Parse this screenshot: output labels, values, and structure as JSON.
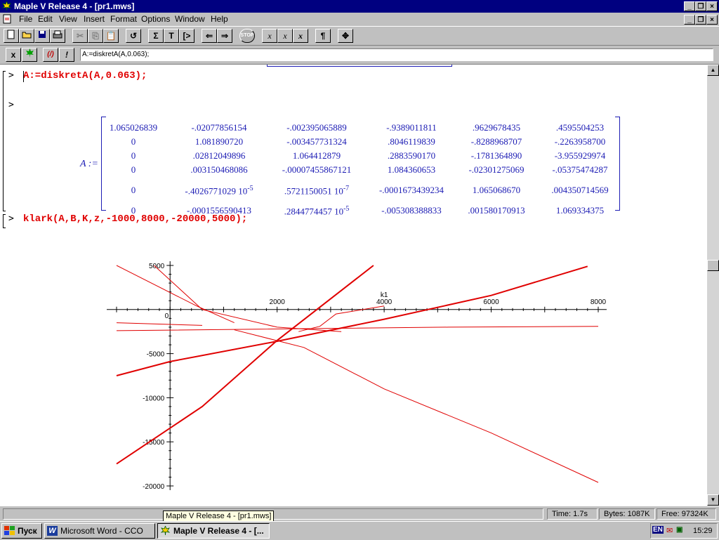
{
  "window": {
    "title": "Maple V Release 4 - [pr1.mws]"
  },
  "menu": [
    "File",
    "Edit",
    "View",
    "Insert",
    "Format",
    "Options",
    "Window",
    "Help"
  ],
  "toolbar": {
    "sigma": "Σ",
    "text": "T",
    "input": "[>",
    "para": "¶",
    "x1": "x",
    "x2": "x",
    "x3": "x"
  },
  "context": {
    "btn_x": "x",
    "btn_fn": "(/)",
    "btn_excl": "!",
    "command": "A:=diskretA(A,0.063);"
  },
  "worksheet": {
    "cmd1": "A:=diskretA(A,0.063);",
    "cmd2": "klark(A,B,K,z,-1000,8000,-20000,5000);",
    "prompt": ">",
    "matrix_label": "A :=",
    "matrix": [
      [
        "1.065026839",
        "-.02077856154",
        "-.002395065889",
        "-.9389011811",
        ".9629678435",
        ".4595504253"
      ],
      [
        "0",
        "1.081890720",
        "-.003457731324",
        ".8046119839",
        "-.8288968707",
        "-.2263958700"
      ],
      [
        "0",
        ".02812049896",
        "1.064412879",
        ".2883590170",
        "-.1781364890",
        "-3.955929974"
      ],
      [
        "0",
        ".003150468086",
        "-.00007455867121",
        "1.084360653",
        "-.02301275069",
        "-.05375474287"
      ],
      [
        "0",
        "-.4026771029 10",
        ".5721150051 10",
        "-.0001673439234",
        "1.065068670",
        ".004350714569"
      ],
      [
        "0",
        "-.0001556590413",
        ".2844774457 10",
        "-.005308388833",
        ".001580170913",
        "1.069334375"
      ]
    ],
    "exponents": {
      "e5": "-5",
      "e7": "-7",
      "e5b": "-5"
    }
  },
  "chart_data": {
    "type": "line",
    "xlabel": "k1",
    "ylabel": "",
    "xlim": [
      -1000,
      8000
    ],
    "ylim": [
      -20000,
      5000
    ],
    "x_ticks": [
      "2000",
      "4000",
      "6000",
      "8000"
    ],
    "y_ticks": [
      "5000",
      "0",
      "-5000",
      "-10000",
      "-15000",
      "-20000"
    ],
    "x_origin_label": "0",
    "series": [
      {
        "x": [
          -1000,
          500,
          1200
        ],
        "y": [
          5000,
          400,
          -1500
        ]
      },
      {
        "x": [
          -1000,
          600
        ],
        "y": [
          -1500,
          -1800
        ]
      },
      {
        "x": [
          -1000,
          5200,
          8000
        ],
        "y": [
          -2400,
          -2000,
          -1900
        ]
      },
      {
        "x": [
          -1000,
          0,
          2000,
          4000,
          6000,
          7800
        ],
        "y": [
          -7500,
          -5900,
          -3600,
          -1100,
          1600,
          4900
        ]
      },
      {
        "x": [
          -1000,
          600,
          2000,
          3800
        ],
        "y": [
          -17500,
          -11000,
          -3500,
          5000
        ]
      },
      {
        "x": [
          -300,
          600,
          2000,
          3200
        ],
        "y": [
          5000,
          0,
          -2000,
          -2500
        ]
      },
      {
        "x": [
          1200,
          2500,
          4000,
          6000,
          8000
        ],
        "y": [
          -2300,
          -4300,
          -9000,
          -14000,
          -19600
        ]
      },
      {
        "x": [
          2400,
          2800,
          3100,
          4000
        ],
        "y": [
          -2500,
          -1900,
          -500,
          400
        ]
      }
    ]
  },
  "status": {
    "time": "Time:  1.7s",
    "bytes": "Bytes:  1087K",
    "free": "Free:  97324K"
  },
  "tooltip": "Maple V Release 4 - [pr1.mws]",
  "taskbar": {
    "start": "Пуск",
    "word": "Microsoft Word - CCO",
    "maple": "Maple V Release 4 - [...",
    "lang": "EN",
    "clock": "15:29"
  }
}
